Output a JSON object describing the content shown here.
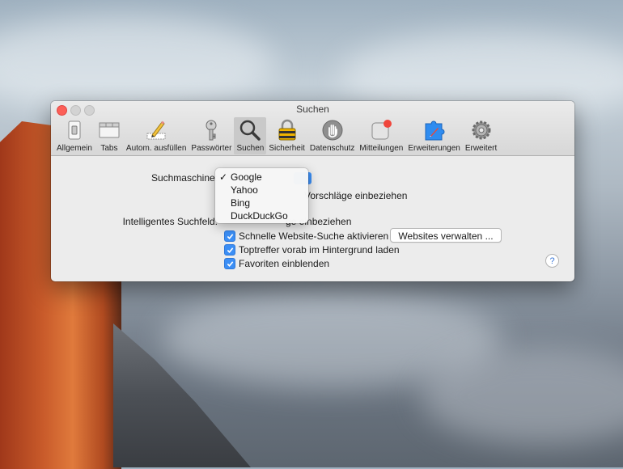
{
  "window": {
    "title": "Suchen"
  },
  "toolbar": {
    "items": [
      {
        "label": "Allgemein",
        "icon": "switch-icon"
      },
      {
        "label": "Tabs",
        "icon": "tabs-icon"
      },
      {
        "label": "Autom. ausfüllen",
        "icon": "pencil-icon"
      },
      {
        "label": "Passwörter",
        "icon": "key-icon"
      },
      {
        "label": "Suchen",
        "icon": "magnifier-icon",
        "selected": true
      },
      {
        "label": "Sicherheit",
        "icon": "lock-icon"
      },
      {
        "label": "Datenschutz",
        "icon": "hand-icon"
      },
      {
        "label": "Mitteilungen",
        "icon": "notification-icon"
      },
      {
        "label": "Erweiterungen",
        "icon": "puzzle-icon"
      },
      {
        "label": "Erweitert",
        "icon": "gear-icon"
      }
    ]
  },
  "search": {
    "engine_label": "Suchmaschine:",
    "suggestions_text": "Vorschläge einbeziehen",
    "smart_label": "Intelligentes Suchfeld:",
    "smart_text": "ge einbeziehen",
    "quick_search": "Schnelle Website-Suche aktivieren",
    "manage_button": "Websites verwalten ...",
    "preload": "Toptreffer vorab im Hintergrund laden",
    "favorites": "Favoriten einblenden",
    "help": "?"
  },
  "dropdown": {
    "options": [
      "Google",
      "Yahoo",
      "Bing",
      "DuckDuckGo"
    ],
    "selected": "Google",
    "check": "✓"
  },
  "colors": {
    "accent": "#3b8ef5",
    "close": "#fc5f57"
  }
}
